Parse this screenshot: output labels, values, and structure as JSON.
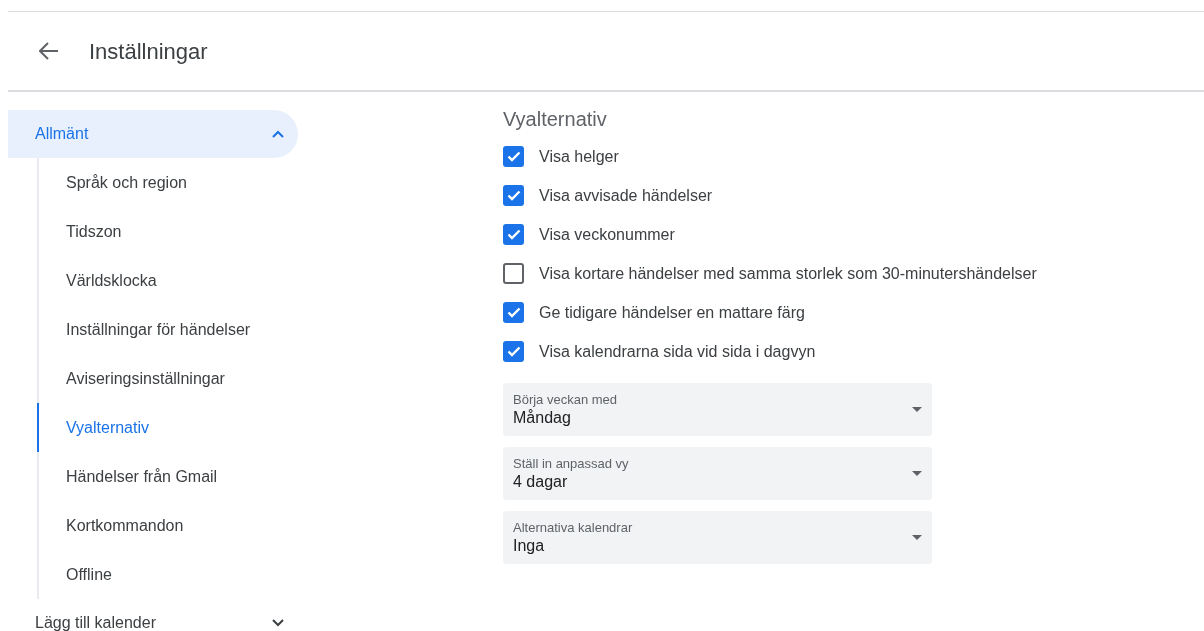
{
  "header": {
    "title": "Inställningar"
  },
  "sidebar": {
    "sections": [
      {
        "label": "Allmänt",
        "selected": true,
        "expanded": true,
        "children": [
          {
            "label": "Språk och region",
            "selected": false
          },
          {
            "label": "Tidszon",
            "selected": false
          },
          {
            "label": "Världsklocka",
            "selected": false
          },
          {
            "label": "Inställningar för händelser",
            "selected": false
          },
          {
            "label": "Aviseringsinställningar",
            "selected": false
          },
          {
            "label": "Vyalternativ",
            "selected": true
          },
          {
            "label": "Händelser från Gmail",
            "selected": false
          },
          {
            "label": "Kortkommandon",
            "selected": false
          },
          {
            "label": "Offline",
            "selected": false
          }
        ]
      },
      {
        "label": "Lägg till kalender",
        "selected": false,
        "expanded": false
      }
    ]
  },
  "content": {
    "title": "Vyalternativ",
    "options": [
      {
        "label": "Visa helger",
        "checked": true
      },
      {
        "label": "Visa avvisade händelser",
        "checked": true
      },
      {
        "label": "Visa veckonummer",
        "checked": true
      },
      {
        "label": "Visa kortare händelser med samma storlek som 30-minutershändelser",
        "checked": false
      },
      {
        "label": "Ge tidigare händelser en mattare färg",
        "checked": true
      },
      {
        "label": "Visa kalendrarna sida vid sida i dagvyn",
        "checked": true
      }
    ],
    "selects": [
      {
        "label": "Börja veckan med",
        "value": "Måndag"
      },
      {
        "label": "Ställ in anpassad vy",
        "value": "4 dagar"
      },
      {
        "label": "Alternativa kalendrar",
        "value": "Inga"
      }
    ]
  }
}
